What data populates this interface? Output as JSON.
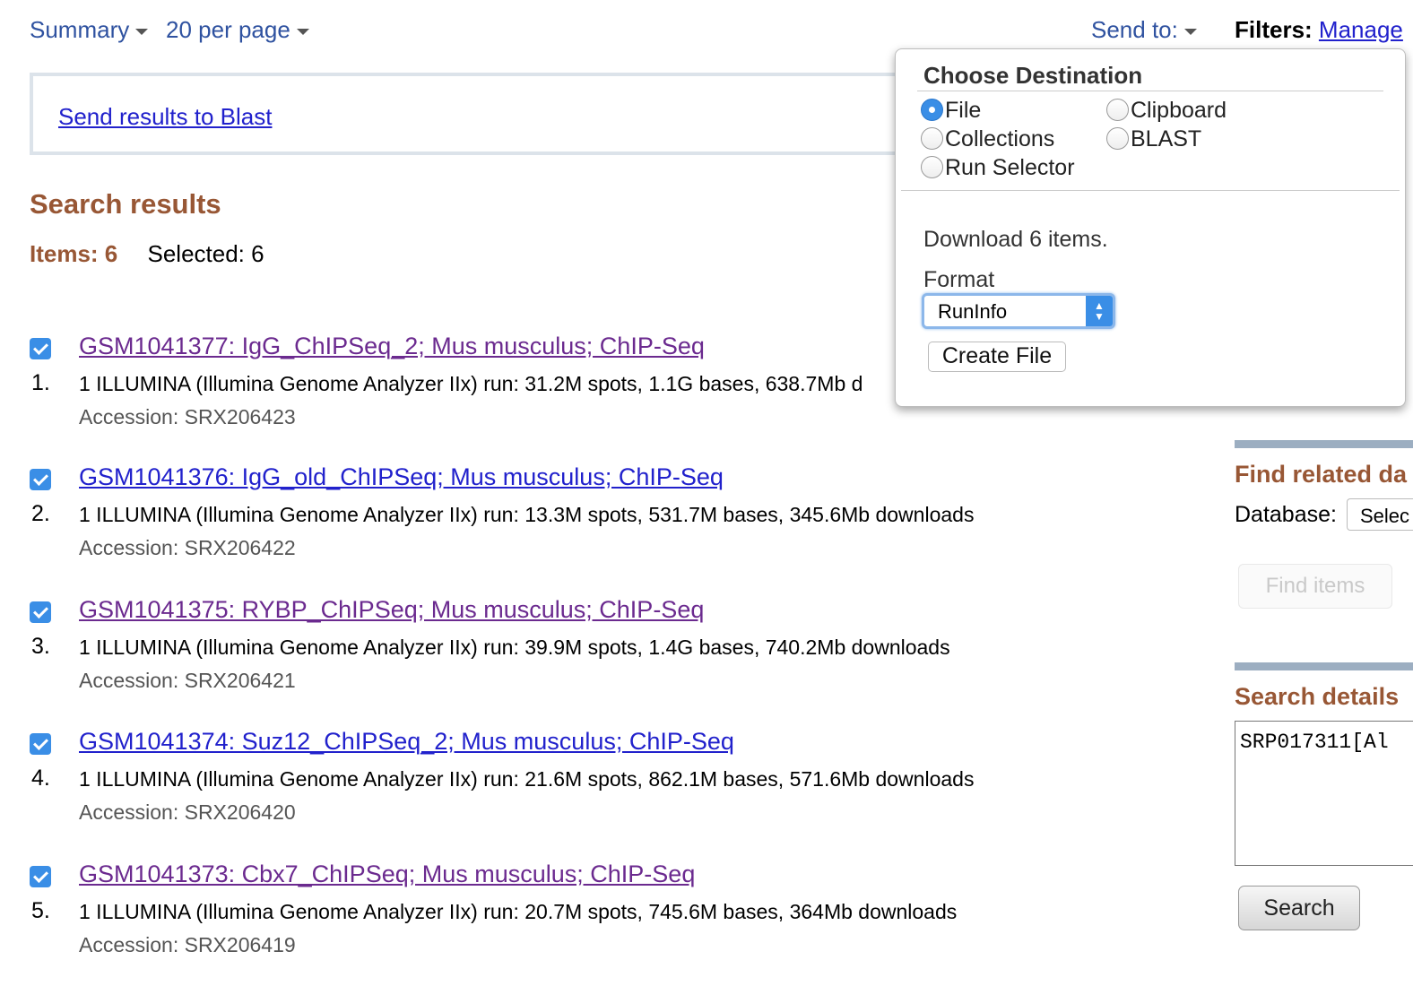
{
  "toolbar": {
    "summary_label": "Summary",
    "per_page_label": "20 per page",
    "send_to_label": "Send to:",
    "filters_label": "Filters:",
    "manage_label": "Manage"
  },
  "blast_box": {
    "link": "Send results to Blast"
  },
  "search_results": {
    "title": "Search results",
    "items_label": "Items: 6",
    "selected_label": "Selected: 6"
  },
  "results": [
    {
      "num": "1.",
      "title": "GSM1041377: IgG_ChIPSeq_2; Mus musculus; ChIP-Seq",
      "desc": "1 ILLUMINA (Illumina Genome Analyzer IIx) run: 31.2M spots, 1.1G bases, 638.7Mb d",
      "accession": "Accession: SRX206423"
    },
    {
      "num": "2.",
      "title": "GSM1041376: IgG_old_ChIPSeq; Mus musculus; ChIP-Seq",
      "desc": "1 ILLUMINA (Illumina Genome Analyzer IIx) run: 13.3M spots, 531.7M bases, 345.6Mb downloads",
      "accession": "Accession: SRX206422"
    },
    {
      "num": "3.",
      "title": "GSM1041375: RYBP_ChIPSeq; Mus musculus; ChIP-Seq",
      "desc": "1 ILLUMINA (Illumina Genome Analyzer IIx) run: 39.9M spots, 1.4G bases, 740.2Mb downloads",
      "accession": "Accession: SRX206421"
    },
    {
      "num": "4.",
      "title": "GSM1041374: Suz12_ChIPSeq_2; Mus musculus; ChIP-Seq",
      "desc": "1 ILLUMINA (Illumina Genome Analyzer IIx) run: 21.6M spots, 862.1M bases, 571.6Mb downloads",
      "accession": "Accession: SRX206420"
    },
    {
      "num": "5.",
      "title": "GSM1041373: Cbx7_ChIPSeq; Mus musculus; ChIP-Seq",
      "desc": "1 ILLUMINA (Illumina Genome Analyzer IIx) run: 20.7M spots, 745.6M bases, 364Mb downloads",
      "accession": "Accession: SRX206419"
    }
  ],
  "popup": {
    "title": "Choose Destination",
    "options": {
      "file": "File",
      "clipboard": "Clipboard",
      "collections": "Collections",
      "blast": "BLAST",
      "run_selector": "Run Selector"
    },
    "selected": "File",
    "download_text": "Download 6 items.",
    "format_label": "Format",
    "format_value": "RunInfo",
    "create_button": "Create File"
  },
  "sidebar": {
    "find_related_title": "Find related da",
    "database_label": "Database:",
    "database_value": "Selec",
    "find_items_button": "Find items",
    "search_details_title": "Search details",
    "search_details_query": "SRP017311[Al",
    "search_button": "Search"
  },
  "colors": {
    "accent": "#985735",
    "link": "#2121cc",
    "visited": "#6b2a8f",
    "checkbox": "#3a8ee6"
  }
}
